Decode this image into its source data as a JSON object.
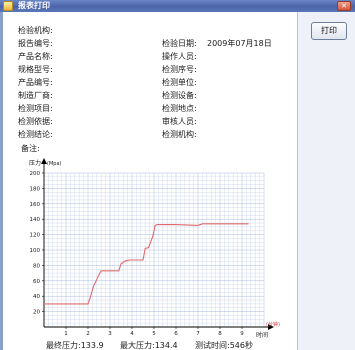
{
  "window": {
    "title": "报表打印"
  },
  "toolbar": {
    "print_label": "打印"
  },
  "report": {
    "fields": [
      {
        "label": "检验机构:",
        "value": ""
      },
      {
        "label": "报告编号:",
        "value": ""
      },
      {
        "label": "检验日期:",
        "value": "2009年07月18日"
      },
      {
        "label": "产品名称:",
        "value": ""
      },
      {
        "label": "操作人员:",
        "value": ""
      },
      {
        "label": "规格型号:",
        "value": ""
      },
      {
        "label": "检测序号:",
        "value": ""
      },
      {
        "label": "产品编号:",
        "value": ""
      },
      {
        "label": "检测单位:",
        "value": ""
      },
      {
        "label": "制造厂商:",
        "value": ""
      },
      {
        "label": "检测设备:",
        "value": ""
      },
      {
        "label": "检测项目:",
        "value": ""
      },
      {
        "label": "检测地点:",
        "value": ""
      },
      {
        "label": "检测依据:",
        "value": ""
      },
      {
        "label": "审核人员:",
        "value": ""
      },
      {
        "label": "检测结论:",
        "value": ""
      },
      {
        "label": "检测机构:",
        "value": ""
      },
      {
        "label": "备注:",
        "value": ""
      }
    ],
    "stats": {
      "min_pressure": "最终压力:133.9",
      "max_pressure": "最大压力:134.4",
      "test_time": "测试时间:546秒"
    }
  },
  "chart_data": {
    "type": "line",
    "ylabel": "压力",
    "yunit": "Mpa",
    "xlabel": "时间",
    "xunit": "分钟",
    "xlim": [
      0,
      10
    ],
    "ylim": [
      0,
      200
    ],
    "x_ticks": [
      "1",
      "2",
      "3",
      "4",
      "5",
      "6",
      "7",
      "8",
      "9"
    ],
    "y_ticks": [
      "20",
      "40",
      "60",
      "80",
      "100",
      "120",
      "140",
      "160",
      "180",
      "200"
    ],
    "grid": true,
    "series": [
      {
        "color": "#e06a6a",
        "x": [
          0,
          2.0,
          2.1,
          2.25,
          2.4,
          2.5,
          2.6,
          3.4,
          3.5,
          3.7,
          3.9,
          4.5,
          4.6,
          4.75,
          4.95,
          5.05,
          5.15,
          6.0,
          7.0,
          7.2,
          9.0,
          9.3
        ],
        "y": [
          30,
          30,
          38,
          53,
          62,
          68,
          73,
          73,
          82,
          86,
          87,
          87,
          102,
          103,
          118,
          132,
          133,
          133,
          132,
          134,
          134,
          134
        ]
      }
    ]
  }
}
